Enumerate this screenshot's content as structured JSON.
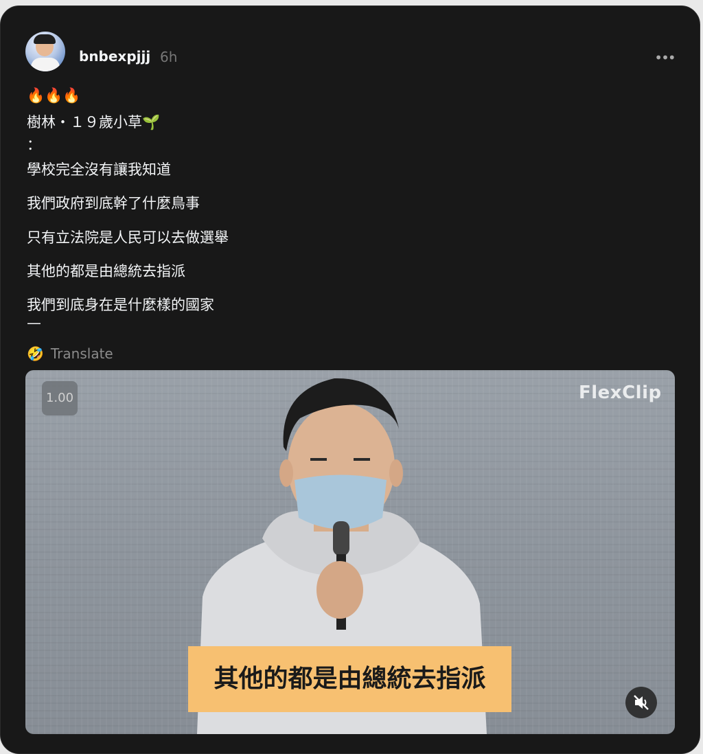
{
  "post": {
    "username": "bnbexpjjj",
    "time": "6h",
    "more_label": "•••",
    "lines": [
      "🔥🔥🔥",
      "樹林・１９歲小草🌱",
      "：",
      "學校完全沒有讓我知道",
      "我們政府到底幹了什麼鳥事",
      "只有立法院是人民可以去做選舉",
      "其他的都是由總統去指派",
      "我們到底身在是什麼樣的國家",
      "—"
    ],
    "translate_icon": "🤣",
    "translate_label": "Translate"
  },
  "video": {
    "speed": "1.00",
    "watermark": "FlexClip",
    "subtitle": "其他的都是由總統去指派",
    "mute_icon": "speaker-muted-icon"
  }
}
